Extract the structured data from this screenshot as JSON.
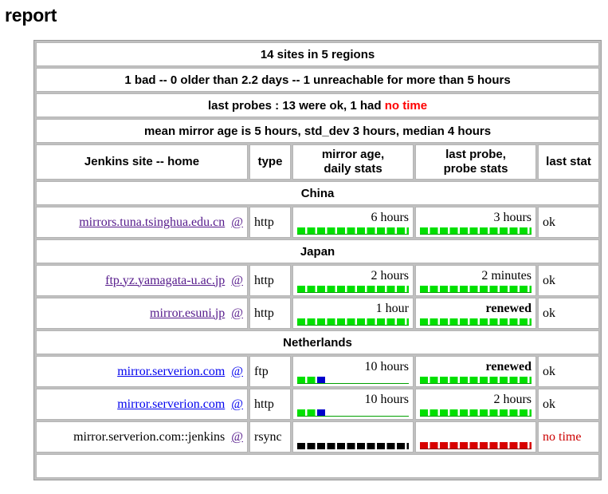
{
  "page": {
    "title": "report"
  },
  "banners": [
    {
      "text": "14 sites in 5 regions"
    },
    {
      "text": "1 bad -- 0 older than 2.2 days -- 1 unreachable for more than 5 hours"
    },
    {
      "prefix": "last probes : 13 were ok, 1 had ",
      "highlight": "no time"
    },
    {
      "text": "mean mirror age is 5 hours, std_dev 3 hours, median 4 hours"
    }
  ],
  "columns": {
    "site": "Jenkins site -- home",
    "type": "type",
    "mirror_age_line1": "mirror age,",
    "mirror_age_line2": "daily stats",
    "last_probe_line1": "last probe,",
    "last_probe_line2": "probe stats",
    "last_stat": "last stat"
  },
  "at_symbol": "@",
  "regions": [
    {
      "name": "China",
      "rows": [
        {
          "host": "mirrors.tuna.tsinghua.edu.cn",
          "link_state": "visited",
          "type": "http",
          "mirror_age": "6 hours",
          "mirror_age_bold": false,
          "mirror_bar": "green",
          "last_probe": "3 hours",
          "last_probe_bold": false,
          "probe_bar": "green",
          "last_stat": "ok",
          "last_stat_bad": false
        }
      ]
    },
    {
      "name": "Japan",
      "rows": [
        {
          "host": "ftp.yz.yamagata-u.ac.jp",
          "link_state": "visited",
          "type": "http",
          "mirror_age": "2 hours",
          "mirror_age_bold": false,
          "mirror_bar": "green",
          "last_probe": "2 minutes",
          "last_probe_bold": false,
          "probe_bar": "green",
          "last_stat": "ok",
          "last_stat_bad": false
        },
        {
          "host": "mirror.esuni.jp",
          "link_state": "visited",
          "type": "http",
          "mirror_age": "1 hour",
          "mirror_age_bold": false,
          "mirror_bar": "green",
          "last_probe": "renewed",
          "last_probe_bold": true,
          "probe_bar": "green",
          "last_stat": "ok",
          "last_stat_bad": false
        }
      ]
    },
    {
      "name": "Netherlands",
      "rows": [
        {
          "host": "mirror.serverion.com",
          "link_state": "unvisited",
          "type": "ftp",
          "mirror_age": "10 hours",
          "mirror_age_bold": false,
          "mirror_bar": "green-blue3",
          "last_probe": "renewed",
          "last_probe_bold": true,
          "probe_bar": "green",
          "last_stat": "ok",
          "last_stat_bad": false
        },
        {
          "host": "mirror.serverion.com",
          "link_state": "unvisited",
          "type": "http",
          "mirror_age": "10 hours",
          "mirror_age_bold": false,
          "mirror_bar": "green-blue3",
          "last_probe": "2 hours",
          "last_probe_bold": false,
          "probe_bar": "green",
          "last_stat": "ok",
          "last_stat_bad": false
        },
        {
          "host": "mirror.serverion.com::jenkins",
          "link_state": "plain",
          "type": "rsync",
          "mirror_age": "",
          "mirror_age_bold": false,
          "mirror_bar": "black",
          "last_probe": "",
          "last_probe_bold": false,
          "probe_bar": "red",
          "last_stat": "no time",
          "last_stat_bad": true
        }
      ]
    },
    {
      "name": "",
      "clipped": true,
      "rows": []
    }
  ],
  "colors": {
    "banner_green": "#00f900",
    "header_cyan": "#00ffff",
    "region_yellow": "#ffff00",
    "bad_red": "#ff0000",
    "bar_green": "#00e000",
    "bar_blue": "#0000cc",
    "bar_red": "#d80000",
    "bar_black": "#000000",
    "link_visited": "#551a8b",
    "link_unvisited": "#0000ee"
  }
}
